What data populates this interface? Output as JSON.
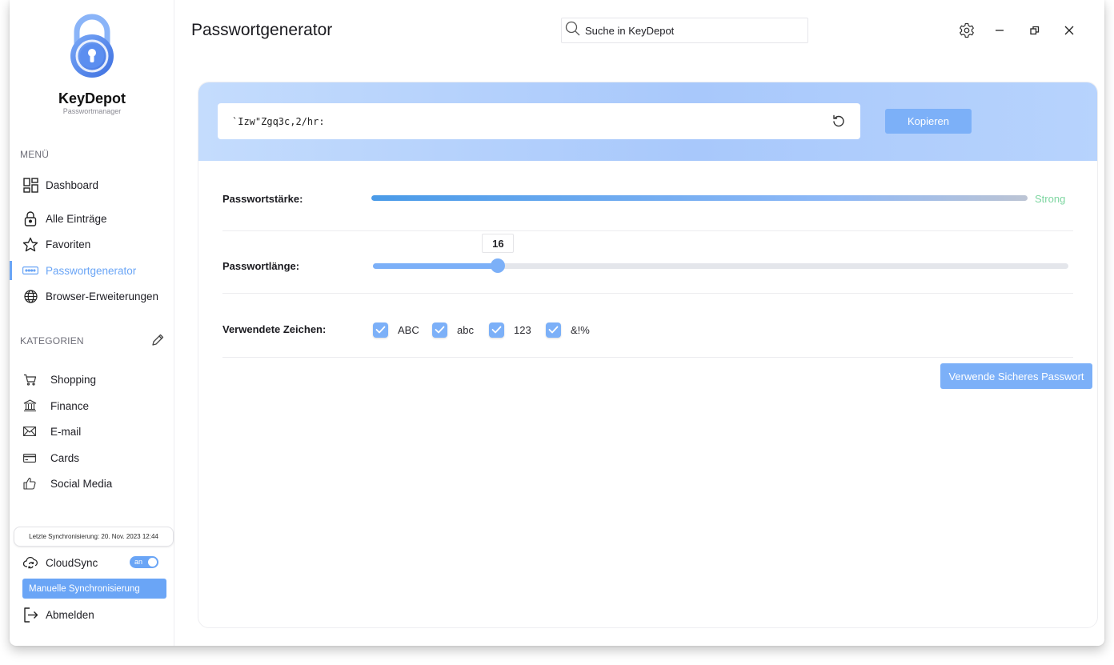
{
  "brand": {
    "name": "KeyDepot",
    "subtitle": "Passwortmanager"
  },
  "sidebar": {
    "menu_title": "MENÜ",
    "items": [
      {
        "label": "Dashboard",
        "icon": "dashboard-icon"
      },
      {
        "label": "Alle Einträge",
        "icon": "lock-icon"
      },
      {
        "label": "Favoriten",
        "icon": "star-icon"
      },
      {
        "label": "Passwortgenerator",
        "icon": "password-dots-icon",
        "active": true
      },
      {
        "label": "Browser-Erweiterungen",
        "icon": "globe-icon"
      }
    ],
    "categories_title": "KATEGORIEN",
    "categories": [
      {
        "label": "Shopping",
        "icon": "cart-icon"
      },
      {
        "label": "Finance",
        "icon": "bank-icon"
      },
      {
        "label": "E-mail",
        "icon": "mail-icon"
      },
      {
        "label": "Cards",
        "icon": "card-icon"
      },
      {
        "label": "Social Media",
        "icon": "thumbs-up-icon"
      }
    ],
    "last_sync": "Letzte Synchronisierung: 20. Nov. 2023 12:44",
    "cloudsync_label": "CloudSync",
    "cloudsync_toggle": "an",
    "cloudsync_on": true,
    "manual_sync_label": "Manuelle Synchronisierung",
    "logout_label": "Abmelden"
  },
  "header": {
    "title": "Passwortgenerator",
    "search_placeholder": "Suche in KeyDepot"
  },
  "generator": {
    "password": "`Izw\"Zgq3c,2/hr:",
    "copy_label": "Kopieren",
    "strength_label": "Passwortstärke:",
    "strength_value": "Strong",
    "strength_fraction": 1.0,
    "length_label": "Passwortlänge:",
    "length_value": "16",
    "length_fraction": 0.18,
    "chars_label": "Verwendete  Zeichen:",
    "char_options": [
      {
        "label": "ABC",
        "checked": true
      },
      {
        "label": "abc",
        "checked": true
      },
      {
        "label": "123",
        "checked": true
      },
      {
        "label": "&!%",
        "checked": true
      }
    ],
    "use_label": "Verwende Sicheres Passwort"
  },
  "colors": {
    "accent": "#6aa5f6",
    "button": "#7cb0f8",
    "strong": "#7ed6a1"
  }
}
